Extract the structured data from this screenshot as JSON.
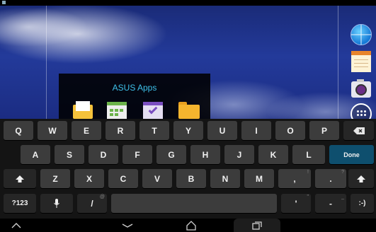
{
  "folder": {
    "title": "ASUS Apps",
    "apps": [
      "mail-icon",
      "calendar-icon",
      "todo-icon",
      "file-manager-icon"
    ]
  },
  "dock": [
    "browser-globe-icon",
    "notes-icon",
    "camera-icon",
    "all-apps-icon"
  ],
  "keyboard": {
    "row1": [
      "Q",
      "W",
      "E",
      "R",
      "T",
      "Y",
      "U",
      "I",
      "O",
      "P"
    ],
    "row2": [
      "A",
      "S",
      "D",
      "F",
      "G",
      "H",
      "J",
      "K",
      "L"
    ],
    "row3": [
      "Z",
      "X",
      "C",
      "V",
      "B",
      "N",
      "M",
      ",",
      "."
    ],
    "row3_hints": {
      "comma": "!",
      "period": "?"
    },
    "done_label": "Done",
    "symbols_label": "?123",
    "slash_label": "/",
    "slash_hint": "@",
    "apostrophe_label": "'",
    "apostrophe_hint": "\"",
    "dash_label": "-",
    "dash_hint": "_",
    "smiley_label": ":-)"
  },
  "colors": {
    "folder_title": "#3ec0ea",
    "done_key": "#0e4f6e",
    "key": "#3c3c3c"
  }
}
